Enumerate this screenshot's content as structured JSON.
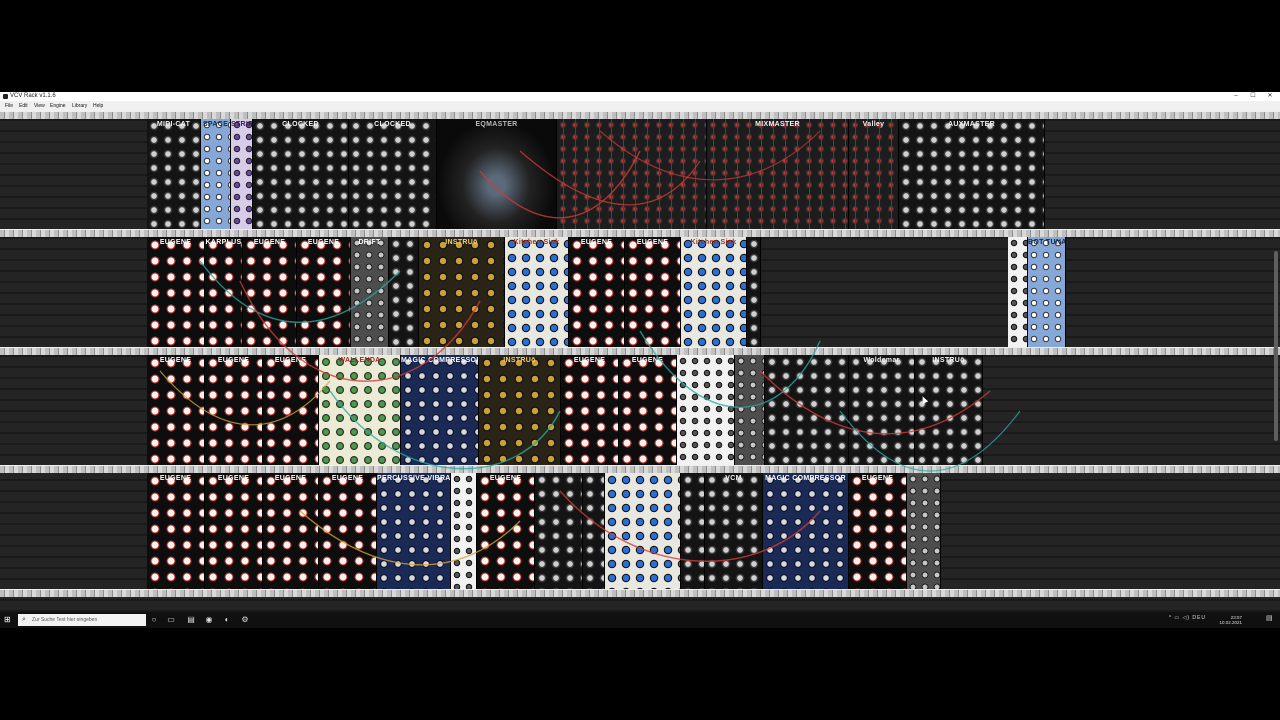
{
  "window": {
    "title": "VCV Rack v1.1.6",
    "controls": [
      "–",
      "☐",
      "✕"
    ]
  },
  "menu": {
    "items": [
      "File",
      "Edit",
      "View",
      "Engine",
      "Library",
      "Help"
    ]
  },
  "rack": {
    "rows": [
      {
        "modules": [
          {
            "label": "MIDI-CAT",
            "style": "dk"
          },
          {
            "label": "SPACE",
            "style": "bl"
          },
          {
            "label": "STRIP",
            "style": "vi"
          },
          {
            "label": "CLOCKED",
            "style": "dk"
          },
          {
            "label": "CLOCKED",
            "style": "dk"
          },
          {
            "label": "EQMASTER",
            "style": "sc"
          },
          {
            "label": "",
            "style": "md"
          },
          {
            "label": "MIXMASTER",
            "style": "md"
          },
          {
            "label": "Valley",
            "style": "md"
          },
          {
            "label": "AUXMASTER",
            "style": "dk"
          }
        ]
      },
      {
        "modules": [
          {
            "label": "EUGENE",
            "style": "eu"
          },
          {
            "label": "KARPLUS",
            "style": "eu"
          },
          {
            "label": "EUGENE",
            "style": "eu"
          },
          {
            "label": "EUGENE",
            "style": "eu"
          },
          {
            "label": "DRIFT",
            "style": "gy"
          },
          {
            "label": "",
            "style": "dk"
          },
          {
            "label": "INSTRUō",
            "style": "gd"
          },
          {
            "label": "Kitchen Sink",
            "style": "lt"
          },
          {
            "label": "EUGENE",
            "style": "eu"
          },
          {
            "label": "EUGENE",
            "style": "eu"
          },
          {
            "label": "Kitchen Sink",
            "style": "lt"
          },
          {
            "label": "",
            "style": "dk"
          }
        ],
        "extra": [
          {
            "label": "",
            "style": "wt"
          },
          {
            "label": "BOT TUNA",
            "style": "bl"
          }
        ]
      },
      {
        "modules": [
          {
            "label": "EUGENE",
            "style": "eu"
          },
          {
            "label": "EUGENE",
            "style": "eu"
          },
          {
            "label": "EUGENE",
            "style": "eu"
          },
          {
            "label": "WALLENDA",
            "style": "cr"
          },
          {
            "label": "MAGIC COMPRESSOR",
            "style": "nv"
          },
          {
            "label": "INSTRUō",
            "style": "gd"
          },
          {
            "label": "EUGENE",
            "style": "eu"
          },
          {
            "label": "EUGENE",
            "style": "eu"
          },
          {
            "label": "",
            "style": "wt"
          },
          {
            "label": "",
            "style": "gy"
          },
          {
            "label": "",
            "style": "dk"
          },
          {
            "label": "Woldemar",
            "style": "dk"
          },
          {
            "label": "INSTRUō",
            "style": "dk"
          }
        ]
      },
      {
        "modules": [
          {
            "label": "EUGENE",
            "style": "eu"
          },
          {
            "label": "EUGENE",
            "style": "eu"
          },
          {
            "label": "EUGENE",
            "style": "eu"
          },
          {
            "label": "EUGENE",
            "style": "eu"
          },
          {
            "label": "PERCUSSIVE VIBRATION",
            "style": "nv"
          },
          {
            "label": "",
            "style": "wt"
          },
          {
            "label": "EUGENE",
            "style": "eu"
          },
          {
            "label": "",
            "style": "dk"
          },
          {
            "label": "",
            "style": "dk"
          },
          {
            "label": "",
            "style": "lt"
          },
          {
            "label": "",
            "style": "dk"
          },
          {
            "label": "VCM",
            "style": "dk"
          },
          {
            "label": "MAGIC COMPRESSOR",
            "style": "nv"
          },
          {
            "label": "EUGENE",
            "style": "eu"
          },
          {
            "label": "",
            "style": "gy"
          }
        ]
      }
    ]
  },
  "taskbar": {
    "search_placeholder": "Zur Suche Text hier eingeben",
    "start_icon": "windows-start-icon",
    "tray_text": "^ ▭ ◁) DEU",
    "time": "23:57",
    "date": "10.02.2021"
  }
}
